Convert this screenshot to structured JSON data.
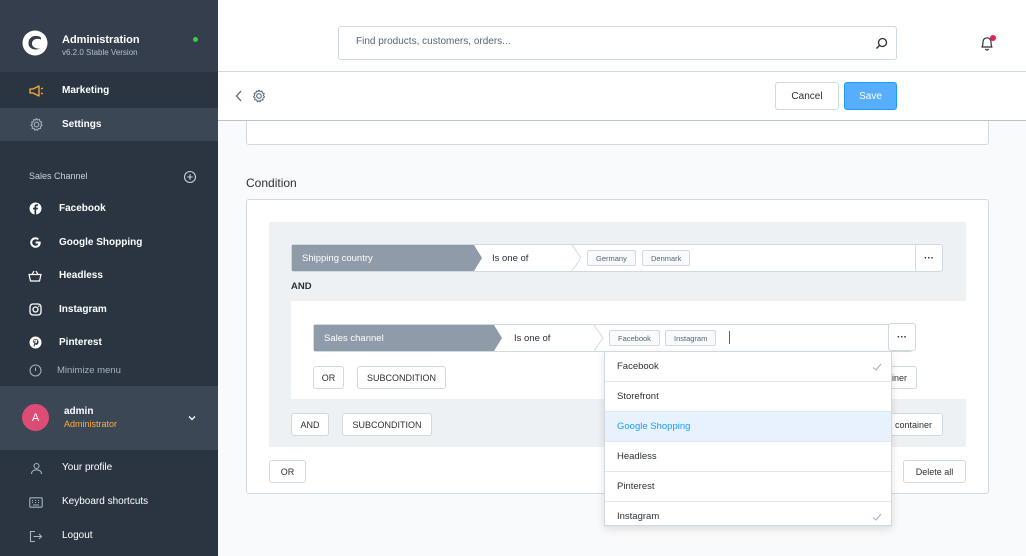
{
  "brand": {
    "title": "Administration",
    "version": "v6.2.0 Stable Version",
    "status_color": "#37d046",
    "logo_icon": "shopware-logo-icon"
  },
  "sidebar": {
    "main_items": [
      {
        "label": "Marketing",
        "icon": "megaphone-icon",
        "active": false
      },
      {
        "label": "Settings",
        "icon": "gear-icon",
        "active": true
      }
    ],
    "sales_channel_title": "Sales Channel",
    "channels": [
      {
        "label": "Facebook",
        "icon": "facebook-icon"
      },
      {
        "label": "Google Shopping",
        "icon": "google-icon"
      },
      {
        "label": "Headless",
        "icon": "basket-icon"
      },
      {
        "label": "Instagram",
        "icon": "instagram-icon"
      },
      {
        "label": "Pinterest",
        "icon": "pinterest-icon"
      }
    ],
    "minimize_label": "Minimize menu",
    "user": {
      "initial": "A",
      "name": "admin",
      "role": "Administrator"
    },
    "footer": [
      {
        "label": "Your profile",
        "icon": "user-icon"
      },
      {
        "label": "Keyboard shortcuts",
        "icon": "keyboard-icon"
      },
      {
        "label": "Logout",
        "icon": "logout-icon"
      }
    ]
  },
  "header": {
    "search_placeholder": "Find products, customers, orders...",
    "notification_color": "#de294c"
  },
  "smartbar": {
    "cancel_label": "Cancel",
    "save_label": "Save",
    "save_color": "#57aeff"
  },
  "condition": {
    "title": "Condition",
    "rule1": {
      "field": "Shipping country",
      "operator": "Is one of",
      "values": [
        "Germany",
        "Denmark"
      ],
      "more": "···"
    },
    "and_label": "AND",
    "rule2": {
      "field": "Sales channel",
      "operator": "Is one of",
      "values": [
        "Facebook",
        "Instagram"
      ],
      "more": "···"
    },
    "inner_buttons": {
      "or": "OR",
      "subcondition": "SUBCONDITION",
      "delete_container_partial": "iner"
    },
    "outer_buttons": {
      "and": "AND",
      "subcondition": "SUBCONDITION",
      "delete_container_partial": "container"
    },
    "bottom_buttons": {
      "or": "OR",
      "delete_all": "Delete all"
    }
  },
  "dropdown": {
    "options": [
      {
        "label": "Facebook",
        "selected": true,
        "highlighted": false
      },
      {
        "label": "Storefront",
        "selected": false,
        "highlighted": false
      },
      {
        "label": "Google Shopping",
        "selected": false,
        "highlighted": true
      },
      {
        "label": "Headless",
        "selected": false,
        "highlighted": false
      },
      {
        "label": "Pinterest",
        "selected": false,
        "highlighted": false
      },
      {
        "label": "Instagram",
        "selected": true,
        "highlighted": false
      }
    ]
  }
}
